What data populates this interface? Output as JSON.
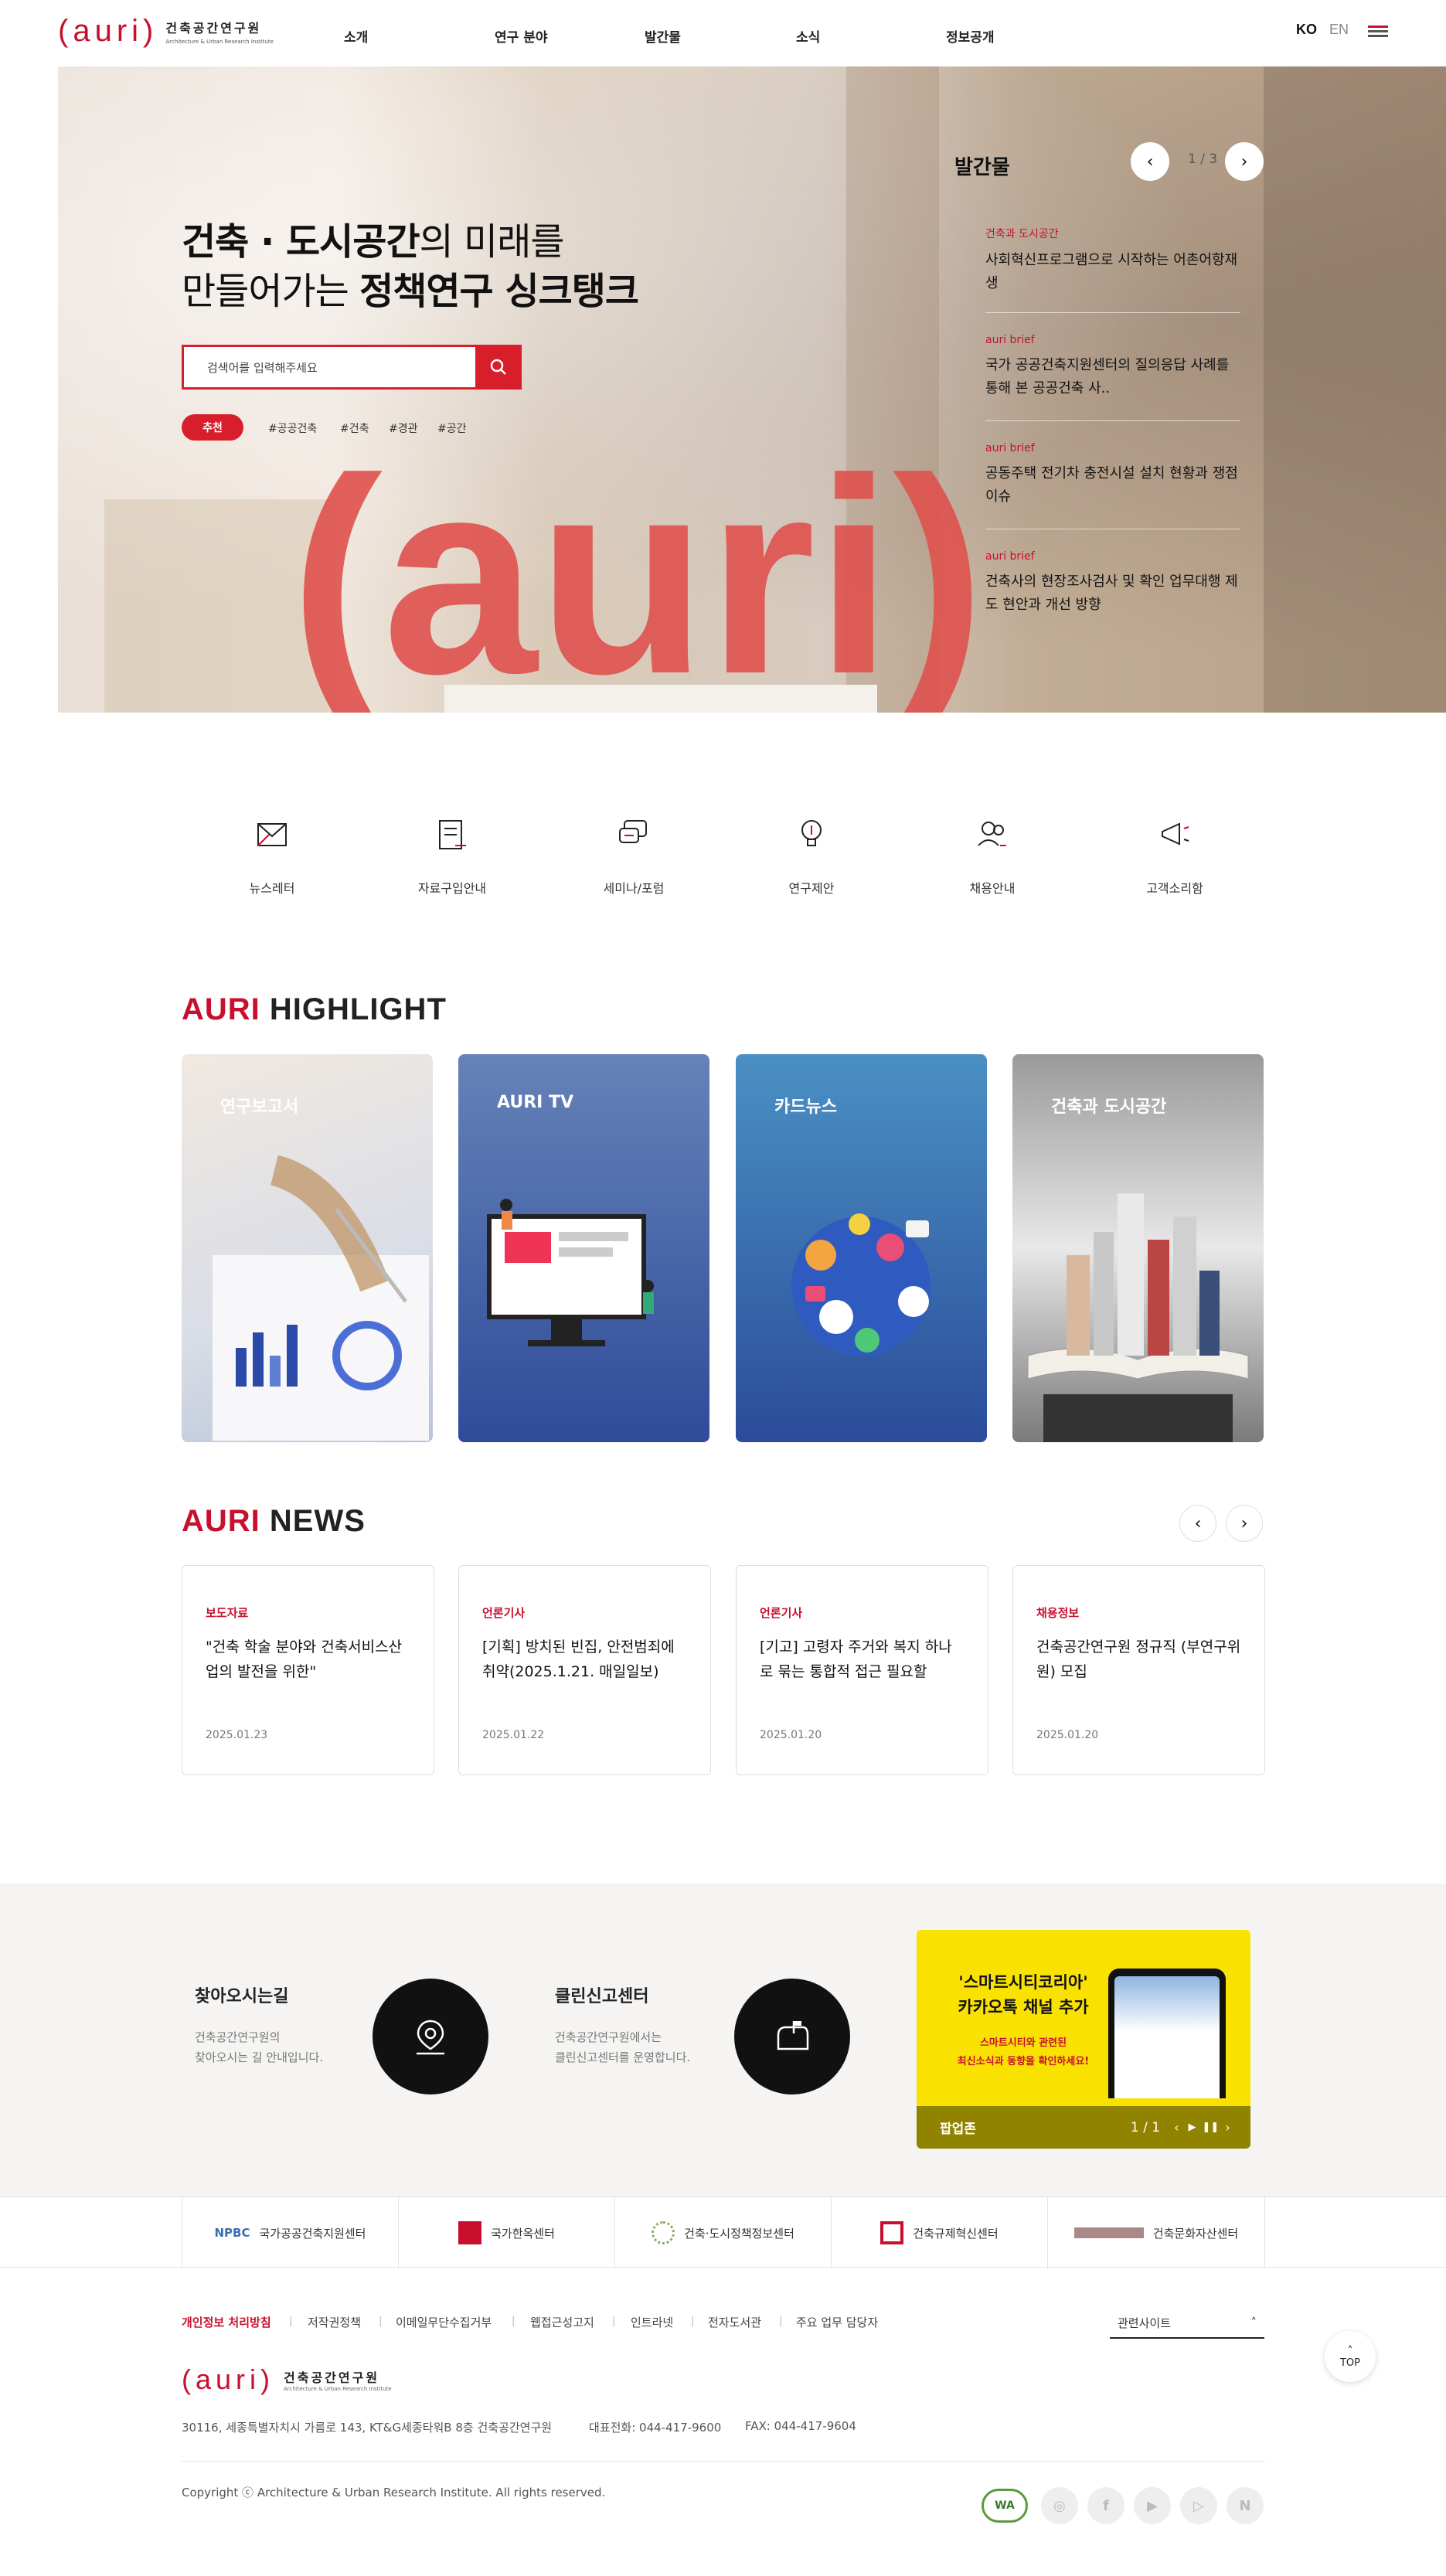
{
  "header": {
    "logo_mark": "(auri)",
    "logo_ko": "건축공간연구원",
    "logo_en": "Architecture & Urban Research Institute",
    "nav": [
      "소개",
      "연구 분야",
      "발간물",
      "소식",
      "정보공개"
    ],
    "lang_ko": "KO",
    "lang_en": "EN"
  },
  "hero": {
    "line1_bold": "건축 · 도시공간",
    "line1_rest": "의 미래를",
    "line2_rest": "만들어가는 ",
    "line2_bold": "정책연구 싱크탱크",
    "search_placeholder": "검색어를 입력해주세요",
    "rec_label": "추천",
    "tags": [
      "#공공건축",
      "#건축",
      "#경관",
      "#공간"
    ],
    "bg_letters": "(auri)"
  },
  "publications": {
    "title": "발간물",
    "pager": "1 / 3",
    "items": [
      {
        "cat": "건축과 도시공간",
        "text": "사회혁신프로그램으로 시작하는 어촌어항재생"
      },
      {
        "cat": "auri brief",
        "text": "국가 공공건축지원센터의 질의응답 사례를 통해 본 공공건축 사.."
      },
      {
        "cat": "auri brief",
        "text": "공동주택 전기차 충전시설 설치 현황과 쟁점 이슈"
      },
      {
        "cat": "auri brief",
        "text": "건축사의 현장조사검사 및 확인 업무대행 제도 현안과 개선 방향"
      }
    ]
  },
  "quick_menu": [
    "뉴스레터",
    "자료구입안내",
    "세미나/포럼",
    "연구제안",
    "채용안내",
    "고객소리함"
  ],
  "highlight": {
    "title_red": "AURI",
    "title_rest": " HIGHLIGHT",
    "cards": [
      "연구보고서",
      "AURI TV",
      "카드뉴스",
      "건축과 도시공간"
    ]
  },
  "news": {
    "title_red": "AURI",
    "title_rest": " NEWS",
    "items": [
      {
        "cat": "보도자료",
        "text": "\"건축 학술 분야와 건축서비스산업의 발전을 위한\"",
        "date": "2025.01.23"
      },
      {
        "cat": "언론기사",
        "text": "[기획] 방치된 빈집, 안전범죄에 취약(2025.1.21. 매일일보)",
        "date": "2025.01.22"
      },
      {
        "cat": "언론기사",
        "text": "[기고] 고령자 주거와 복지 하나로 묶는 통합적 접근 필요할",
        "date": "2025.01.20"
      },
      {
        "cat": "채용정보",
        "text": "건축공간연구원 정규직 (부연구위원) 모집",
        "date": "2025.01.20"
      }
    ]
  },
  "band": {
    "directions_title": "찾아오시는길",
    "directions_desc1": "건축공간연구원의",
    "directions_desc2": "찾아오시는 길 안내입니다.",
    "report_title": "클린신고센터",
    "report_desc1": "건축공간연구원에서는",
    "report_desc2": "클린신고센터를 운영합니다.",
    "popup": {
      "line1": "'스마트시티코리아'",
      "line2": "카카오톡 채널 추가",
      "line3": "스마트시티와 관련된",
      "line4": "최신소식과 동향을 확인하세요!",
      "bar_label": "팝업존",
      "pager": "1 / 1"
    }
  },
  "family_sites": [
    {
      "logo": "NPBC",
      "name": "국가공공건축지원센터"
    },
    {
      "logo": "",
      "name": "국가한옥센터"
    },
    {
      "logo": "",
      "name": "건축·도시정책정보센터"
    },
    {
      "logo": "",
      "name": "건축규제혁신센터"
    },
    {
      "logo": "",
      "name": "건축문화자산센터"
    }
  ],
  "footer": {
    "links": [
      "개인정보 처리방침",
      "저작권정책",
      "이메일무단수집거부",
      "웹접근성고지",
      "인트라넷",
      "전자도서관",
      "주요 업무 담당자"
    ],
    "related_sites": "관련사이트",
    "address": "30116, 세종특별자치시 가름로 143, KT&G세종타워B 8층 건축공간연구원",
    "tel": "대표전화: 044-417-9600",
    "fax": "FAX: 044-417-9604",
    "copyright": "Copyright ⓒ Architecture & Urban Research Institute. All rights reserved.",
    "wa_badge": "WA",
    "top": "TOP"
  },
  "colors": {
    "accent": "#c8102e",
    "popup_yellow": "#f9e200"
  }
}
